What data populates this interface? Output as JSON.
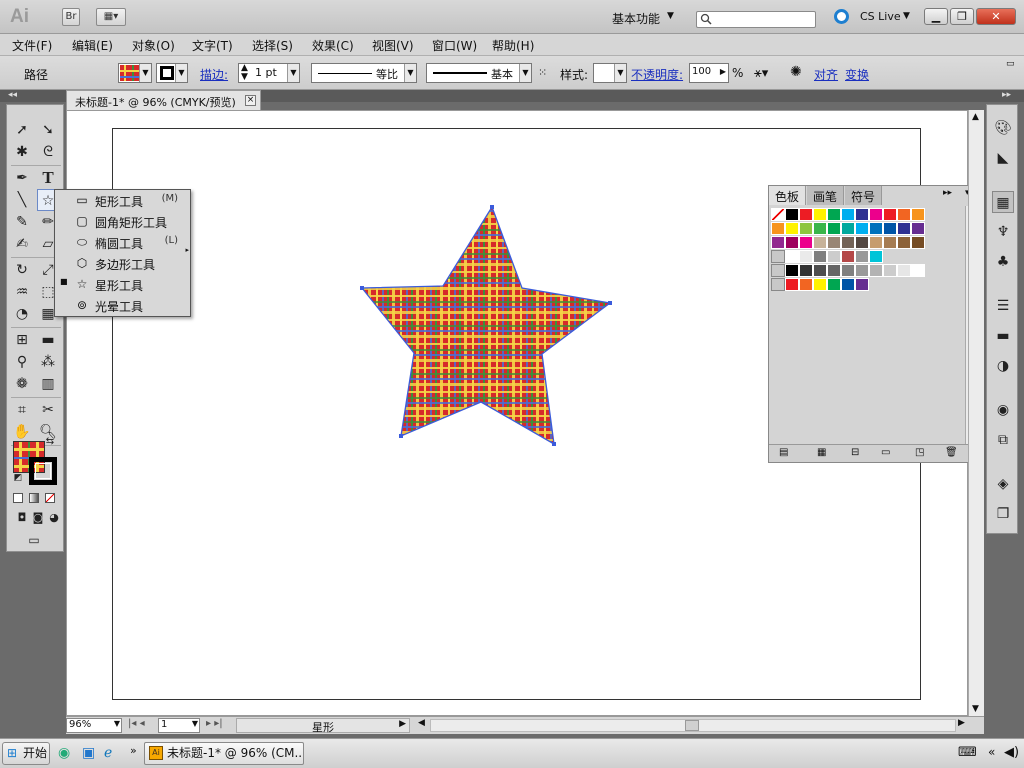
{
  "app": {
    "logo": "Ai",
    "bridge_button": "Br",
    "workspace": "基本功能",
    "cs_live": "CS Live",
    "search_placeholder": ""
  },
  "menu": [
    "文件(F)",
    "编辑(E)",
    "对象(O)",
    "文字(T)",
    "选择(S)",
    "效果(C)",
    "视图(V)",
    "窗口(W)",
    "帮助(H)"
  ],
  "control_bar": {
    "selection_type": "路径",
    "stroke_label": "描边:",
    "stroke_weight": "1 pt",
    "stroke_profile": "等比",
    "brush": "基本",
    "style_label": "样式:",
    "opacity_label": "不透明度:",
    "opacity_value": "100",
    "opacity_unit": "%",
    "align_label": "对齐",
    "transform_label": "变换"
  },
  "document": {
    "tab_title": "未标题-1* @ 96% (CMYK/预览)",
    "tab_close": "×"
  },
  "flyout": {
    "items": [
      {
        "label": "矩形工具",
        "shortcut": "(M)",
        "icon": "rectangle-icon"
      },
      {
        "label": "圆角矩形工具",
        "shortcut": "",
        "icon": "rounded-rectangle-icon"
      },
      {
        "label": "椭圆工具",
        "shortcut": "(L)",
        "icon": "ellipse-icon"
      },
      {
        "label": "多边形工具",
        "shortcut": "",
        "icon": "polygon-icon"
      },
      {
        "label": "星形工具",
        "shortcut": "",
        "icon": "star-icon",
        "active": true
      },
      {
        "label": "光晕工具",
        "shortcut": "",
        "icon": "flare-icon"
      }
    ]
  },
  "swatches_panel": {
    "tabs": [
      "色板",
      "画笔",
      "符号"
    ],
    "row1": [
      "#ffffff",
      "#000000",
      "#ed1c24",
      "#fff200",
      "#00a651",
      "#00aeef",
      "#2e3192",
      "#ec008c",
      "#ed1c24",
      "#f26522",
      "#f7941d"
    ],
    "row2": [
      "#f7941d",
      "#fff200",
      "#8dc63f",
      "#39b54a",
      "#00a651",
      "#00a99d",
      "#00aeef",
      "#0072bc",
      "#0054a6",
      "#2e3192",
      "#662d91"
    ],
    "row3": [
      "#92278f",
      "#9e005d",
      "#ec008c",
      "#c7b299",
      "#998675",
      "#736357",
      "#534741",
      "#c69c6d",
      "#a67c52",
      "#8c6239",
      "#754c24"
    ],
    "row4": [
      "#ffffff",
      "#eaeaea",
      "#7f7f7f",
      "#cccccc",
      "#b54848",
      "#999999",
      "#00c4d8"
    ],
    "row5": [
      "#000000",
      "#333333",
      "#4d4d4d",
      "#666666",
      "#808080",
      "#999999",
      "#b3b3b3",
      "#cccccc",
      "#e6e6e6",
      "#ffffff"
    ],
    "row6": [
      "#ed1c24",
      "#f26522",
      "#fff200",
      "#00a651",
      "#0054a6",
      "#662d91"
    ]
  },
  "status_bar": {
    "zoom": "96%",
    "page": "1",
    "tool_name": "星形"
  },
  "taskbar": {
    "start": "开始",
    "task": "未标题-1* @ 96% (CM..."
  },
  "colors": {
    "plaid_red": "#d62a2a",
    "plaid_yellow": "#f5d547",
    "plaid_green": "#3f8f3a",
    "plaid_blue": "#4a6fd6",
    "selection": "#3b5bdb"
  }
}
